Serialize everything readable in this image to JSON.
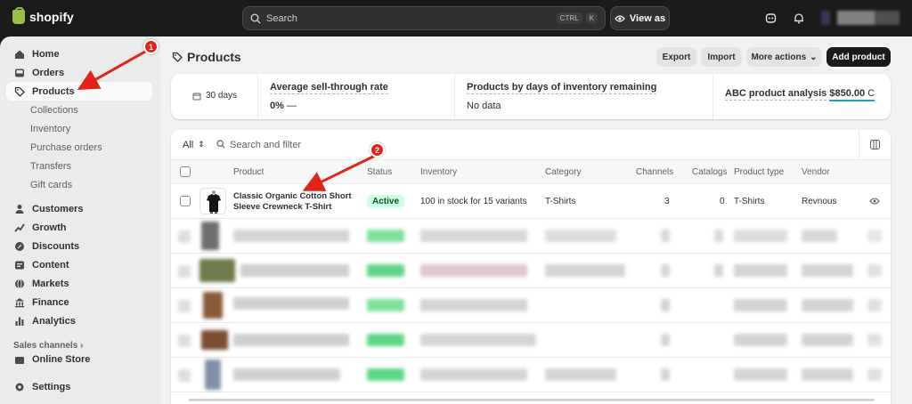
{
  "topbar": {
    "brand": "shopify",
    "search_placeholder": "Search",
    "kbd_ctrl": "CTRL",
    "kbd_k": "K",
    "view_as": "View as"
  },
  "sidebar": {
    "items": [
      {
        "label": "Home"
      },
      {
        "label": "Orders"
      },
      {
        "label": "Products"
      },
      {
        "label": "Collections"
      },
      {
        "label": "Inventory"
      },
      {
        "label": "Purchase orders"
      },
      {
        "label": "Transfers"
      },
      {
        "label": "Gift cards"
      },
      {
        "label": "Customers"
      },
      {
        "label": "Growth"
      },
      {
        "label": "Discounts"
      },
      {
        "label": "Content"
      },
      {
        "label": "Markets"
      },
      {
        "label": "Finance"
      },
      {
        "label": "Analytics"
      }
    ],
    "sales_channels": "Sales channels",
    "online_store": "Online Store",
    "settings": "Settings"
  },
  "page": {
    "title": "Products",
    "export": "Export",
    "import": "Import",
    "more_actions": "More actions",
    "add_product": "Add product"
  },
  "stats": {
    "period": "30 days",
    "sell_through_label": "Average sell-through rate",
    "sell_through_value": "0%",
    "sell_through_trend": "—",
    "days_inventory_label": "Products by days of inventory remaining",
    "days_inventory_value": "No data",
    "abc_label": "ABC product analysis",
    "abc_value": "$850.00",
    "abc_grade": "C"
  },
  "table": {
    "filter_all": "All",
    "filter_placeholder": "Search and filter",
    "headers": {
      "product": "Product",
      "status": "Status",
      "inventory": "Inventory",
      "category": "Category",
      "channels": "Channels",
      "catalogs": "Catalogs",
      "type": "Product type",
      "vendor": "Vendor"
    },
    "row1": {
      "name_line1": "Classic Organic Cotton Short",
      "name_line2": "Sleeve Crewneck T-Shirt",
      "status": "Active",
      "inventory": "100 in stock for 15 variants",
      "category": "T-Shirts",
      "channels": "3",
      "catalogs": "0",
      "type": "T-Shirts",
      "vendor": "Revnous"
    }
  },
  "annotations": {
    "badge1": "1",
    "badge2": "2",
    "color": "#e2231a"
  }
}
